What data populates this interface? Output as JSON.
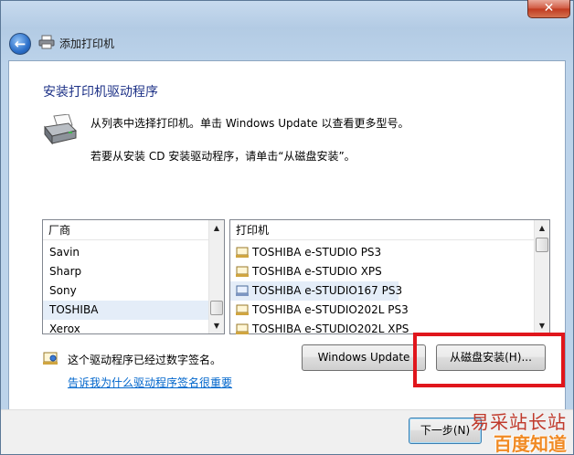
{
  "window": {
    "title": "添加打印机",
    "close_glyph": "✕",
    "back_glyph": "←"
  },
  "main": {
    "heading": "安装打印机驱动程序",
    "instruction_1": "从列表中选择打印机。单击 Windows Update 以查看更多型号。",
    "instruction_2": "若要从安装 CD 安装驱动程序，请单击“从磁盘安装”。"
  },
  "manufacturers": {
    "header": "厂商",
    "items": [
      "Savin",
      "Sharp",
      "Sony",
      "TOSHIBA",
      "Xerox"
    ],
    "selected_index": 3
  },
  "printers": {
    "header": "打印机",
    "items": [
      "TOSHIBA e-STUDIO PS3",
      "TOSHIBA e-STUDIO XPS",
      "TOSHIBA e-STUDIO167 PS3",
      "TOSHIBA e-STUDIO202L PS3",
      "TOSHIBA e-STUDIO202L XPS"
    ],
    "selected_index": 2
  },
  "signature": {
    "text": "这个驱动程序已经过数字签名。",
    "link": "告诉我为什么驱动程序签名很重要"
  },
  "buttons": {
    "windows_update": "Windows Update",
    "have_disk": "从磁盘安装(H)...",
    "next": "下一步(N)"
  },
  "watermark": {
    "line1": "易采站长站",
    "line2": "百度知道"
  },
  "colors": {
    "heading": "#1e3287",
    "link": "#0066cc",
    "highlight_box": "#e0161c"
  }
}
